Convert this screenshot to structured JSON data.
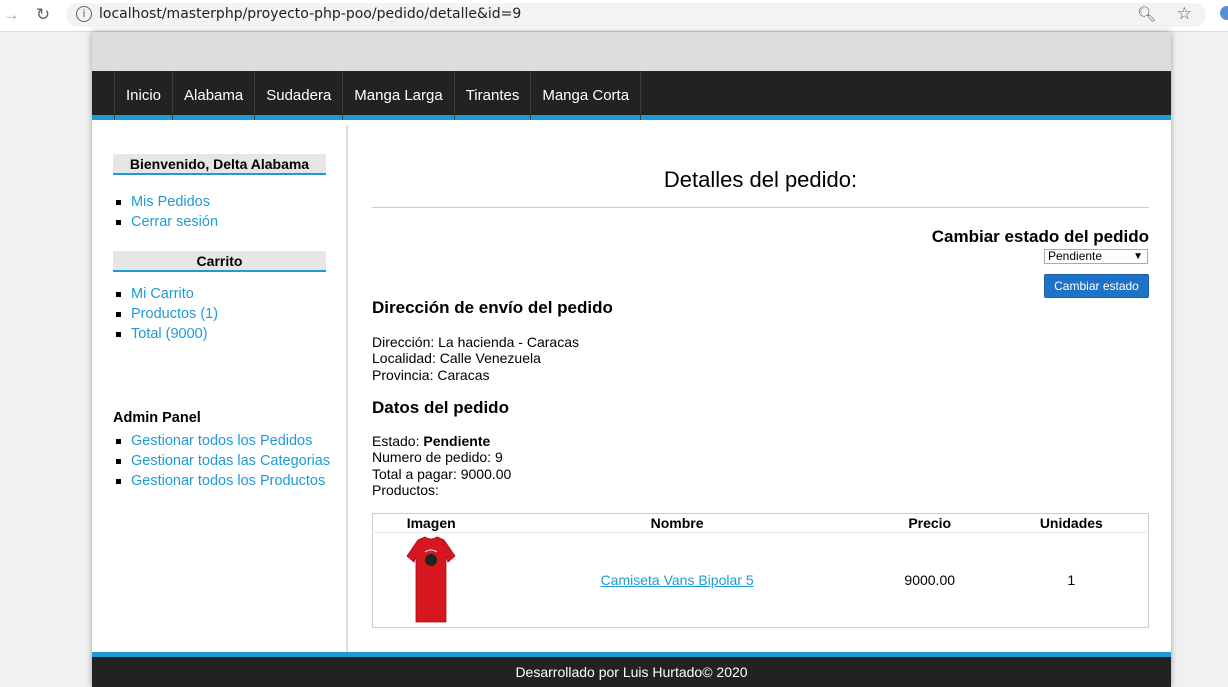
{
  "browser": {
    "url": "localhost/masterphp/proyecto-php-poo/pedido/detalle&id=9"
  },
  "menu": [
    "Inicio",
    "Alabama",
    "Sudadera",
    "Manga Larga",
    "Tirantes",
    "Manga Corta"
  ],
  "sidebar": {
    "welcome_title": "Bienvenido, Delta Alabama",
    "user_links": [
      "Mis Pedidos",
      "Cerrar sesión"
    ],
    "cart_title": "Carrito",
    "cart_links": [
      "Mi Carrito",
      "Productos (1)",
      "Total (9000)"
    ],
    "admin_title": "Admin Panel",
    "admin_links": [
      "Gestionar todos los Pedidos",
      "Gestionar todas las Categorias",
      "Gestionar todos los Productos"
    ]
  },
  "main": {
    "title": "Detalles del pedido:",
    "change_state_title": "Cambiar estado del pedido",
    "state_select_value": "Pendiente",
    "change_state_button": "Cambiar estado",
    "shipping_title": "Dirección de envío del pedido",
    "shipping_lines": [
      "Dirección: La hacienda - Caracas",
      "Localidad: Calle Venezuela",
      "Provincia: Caracas"
    ],
    "order_title": "Datos del pedido",
    "estado_label": "Estado: ",
    "estado_value": "Pendiente",
    "order_lines": [
      "Numero de pedido: 9",
      "Total a pagar: 9000.00",
      "Productos:"
    ],
    "table": {
      "headers": [
        "Imagen",
        "Nombre",
        "Precio",
        "Unidades"
      ],
      "rows": [
        {
          "name": "Camiseta Vans Bipolar 5",
          "price": "9000.00",
          "units": "1"
        }
      ]
    }
  },
  "footer": "Desarrollado por Luis Hurtado© 2020",
  "colors": {
    "accent": "#1e9bd7",
    "dark": "#222222",
    "button": "#1e73c8",
    "shirt": "#d8161f"
  }
}
